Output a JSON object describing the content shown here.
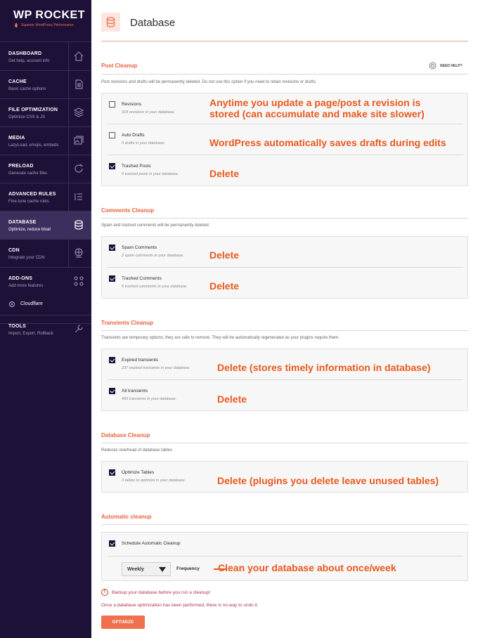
{
  "brand": {
    "name": "WP ROCKET",
    "tagline": "Superior WordPress Performance"
  },
  "sidebar": {
    "items": [
      {
        "title": "DASHBOARD",
        "sub": "Get help, account info",
        "icon": "home-icon"
      },
      {
        "title": "CACHE",
        "sub": "Basic cache options",
        "icon": "file-icon"
      },
      {
        "title": "FILE OPTIMIZATION",
        "sub": "Optimize CSS & JS",
        "icon": "layers-icon"
      },
      {
        "title": "MEDIA",
        "sub": "LazyLoad, emojis, embeds",
        "icon": "images-icon"
      },
      {
        "title": "PRELOAD",
        "sub": "Generate cache files",
        "icon": "refresh-icon"
      },
      {
        "title": "ADVANCED RULES",
        "sub": "Fine-tune cache rules",
        "icon": "list-icon"
      },
      {
        "title": "DATABASE",
        "sub": "Optimize, reduce bloat",
        "icon": "database-icon"
      },
      {
        "title": "CDN",
        "sub": "Integrate your CDN",
        "icon": "globe-icon"
      },
      {
        "title": "ADD-ONS",
        "sub": "Add more features",
        "icon": "addons-icon"
      },
      {
        "title": "TOOLS",
        "sub": "Import, Export, Rollback",
        "icon": "tools-icon"
      }
    ],
    "cloudflare": "Cloudflare",
    "active_index": 6
  },
  "page": {
    "title": "Database"
  },
  "need_help": "NEED HELP?",
  "sections": {
    "post": {
      "title": "Post Cleanup",
      "desc": "Post revisions and drafts will be permanently deleted. Do not use this option if you need to retain revisions or drafts.",
      "rows": [
        {
          "label": "Revisions",
          "sub": "318 revisions in your database.",
          "checked": false
        },
        {
          "label": "Auto Drafts",
          "sub": "0 drafts in your database.",
          "checked": false
        },
        {
          "label": "Trashed Posts",
          "sub": "0 trashed posts in your database.",
          "checked": true
        }
      ]
    },
    "comments": {
      "title": "Comments Cleanup",
      "desc": "Spam and trashed comments will be permanently deleted.",
      "rows": [
        {
          "label": "Spam Comments",
          "sub": "2 spam comments in your database.",
          "checked": true
        },
        {
          "label": "Trashed Comments",
          "sub": "5 trashed comments in your database.",
          "checked": true
        }
      ]
    },
    "transients": {
      "title": "Transients Cleanup",
      "desc": "Transients are temporary options; they are safe to remove. They will be automatically regenerated as your plugins require them.",
      "rows": [
        {
          "label": "Expired transients",
          "sub": "237 expired transients in your database.",
          "checked": true
        },
        {
          "label": "All transients",
          "sub": "495 transients in your database.",
          "checked": true
        }
      ]
    },
    "database": {
      "title": "Database Cleanup",
      "desc": "Reduces overhead of database tables",
      "rows": [
        {
          "label": "Optimize Tables",
          "sub": "3 tables to optimize in your database.",
          "checked": true
        }
      ]
    },
    "automatic": {
      "title": "Automatic cleanup",
      "schedule_label": "Schedule Automatic Cleanup",
      "schedule_checked": true,
      "frequency_value": "Weekly",
      "frequency_label": "Frequency"
    }
  },
  "annotations": {
    "revisions_1": "Anytime you update a page/post a revision is",
    "revisions_2": "stored (can accumulate and make site slower)",
    "drafts": "WordPress automatically saves drafts during edits",
    "trashed_posts": "Delete",
    "spam": "Delete",
    "trashed_comments": "Delete",
    "expired": "Delete (stores timely information in database)",
    "all_transients": "Delete",
    "tables": "Delete (plugins you delete leave unused tables)",
    "frequency": "Clean your database about once/week"
  },
  "warnings": {
    "backup": "Backup your database before you run a cleanup!",
    "irreversible": "Once a database optimization has been performed, there is no way to undo it."
  },
  "optimize_button": "OPTIMIZE",
  "colors": {
    "sidebar_bg": "#1d1138",
    "accent": "#f0714d",
    "annotation": "#e8591f"
  }
}
